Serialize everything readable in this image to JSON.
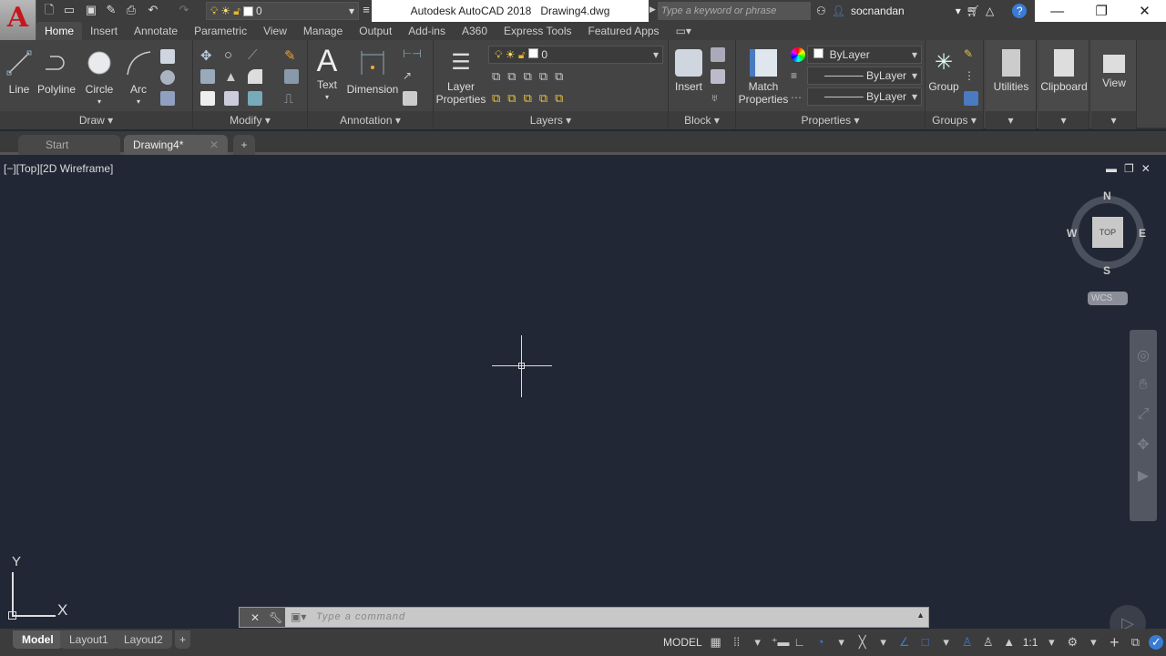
{
  "app": {
    "logo": "A",
    "title": "Autodesk AutoCAD 2018",
    "filename": "Drawing4.dwg"
  },
  "quick_access": {
    "layer_value": "0"
  },
  "search": {
    "placeholder": "Type a keyword or phrase"
  },
  "user": {
    "name": "socnandan"
  },
  "ribbon_tabs": [
    "Home",
    "Insert",
    "Annotate",
    "Parametric",
    "View",
    "Manage",
    "Output",
    "Add-ins",
    "A360",
    "Express Tools",
    "Featured Apps"
  ],
  "panels": {
    "draw": {
      "title": "Draw",
      "tools": [
        "Line",
        "Polyline",
        "Circle",
        "Arc"
      ]
    },
    "modify": {
      "title": "Modify"
    },
    "annotation": {
      "title": "Annotation",
      "tools": [
        "Text",
        "Dimension"
      ]
    },
    "layers": {
      "title": "Layers",
      "layer_properties": "Layer Properties",
      "current_layer": "0"
    },
    "block": {
      "title": "Block",
      "insert": "Insert"
    },
    "properties": {
      "title": "Properties",
      "match": "Match Properties",
      "color": "ByLayer",
      "linetype": "ByLayer",
      "lineweight": "ByLayer"
    },
    "groups": {
      "title": "Groups",
      "group": "Group"
    },
    "utilities": "Utilities",
    "clipboard": "Clipboard",
    "view": "View"
  },
  "file_tabs": [
    "Start",
    "Drawing4*"
  ],
  "viewport": {
    "label": "[−][Top][2D Wireframe]",
    "viewcube": {
      "n": "N",
      "s": "S",
      "e": "E",
      "w": "W",
      "face": "TOP",
      "ucs": "WCS"
    },
    "ucs_x": "X",
    "ucs_y": "Y"
  },
  "command": {
    "placeholder": "Type a command"
  },
  "layout_tabs": [
    "Model",
    "Layout1",
    "Layout2"
  ],
  "status": {
    "model": "MODEL",
    "scale": "1:1"
  },
  "colors": {
    "accent": "#c8161d",
    "viewport_bg": "#212734",
    "ribbon_bg": "#444444"
  }
}
